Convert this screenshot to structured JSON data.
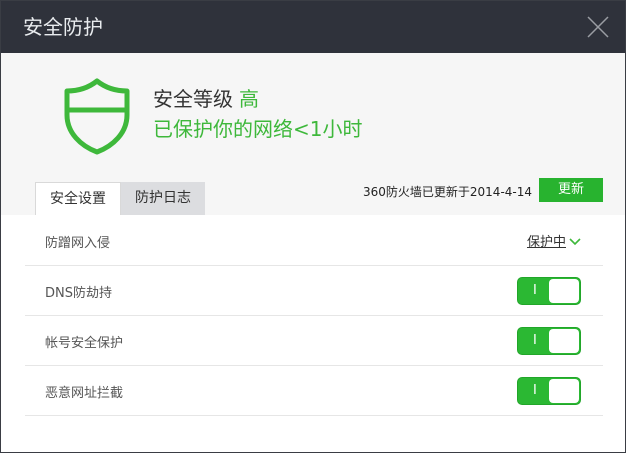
{
  "window": {
    "title": "安全防护"
  },
  "header": {
    "level_prefix": "安全等级",
    "level_value": "高",
    "protect_text": "已保护你的网络<1小时"
  },
  "tabs": [
    {
      "label": "安全设置",
      "active": true
    },
    {
      "label": "防护日志",
      "active": false
    }
  ],
  "update": {
    "info": "360防火墙已更新于2014-4-14",
    "button": "更新"
  },
  "settings": [
    {
      "label": "防蹭网入侵",
      "status": "保护中"
    },
    {
      "label": "DNS防劫持",
      "toggle_on": true,
      "toggle_mark": "I"
    },
    {
      "label": "帐号安全保护",
      "toggle_on": true,
      "toggle_mark": "I"
    },
    {
      "label": "恶意网址拦截",
      "toggle_on": true,
      "toggle_mark": "I"
    }
  ],
  "colors": {
    "accent_green": "#3eb83b",
    "toggle_green": "#2bb833",
    "titlebar": "#2f323b"
  },
  "icons": [
    "shield-icon",
    "close-icon",
    "chevron-down-icon"
  ]
}
